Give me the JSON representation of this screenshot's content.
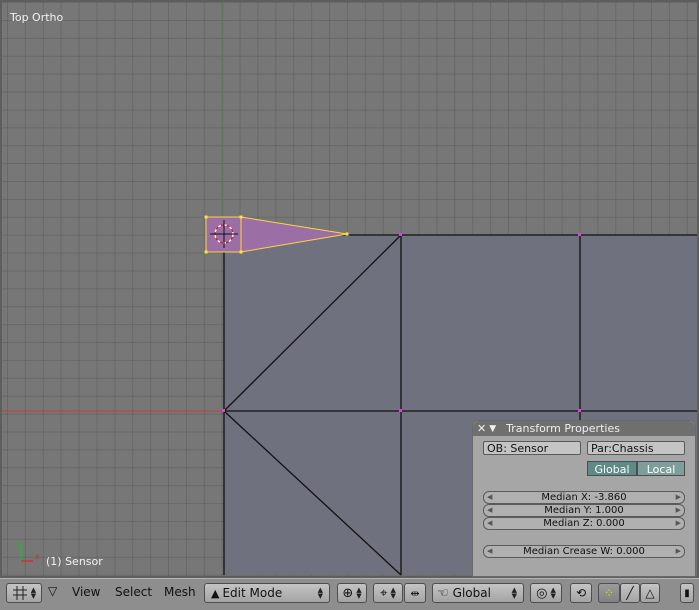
{
  "viewport": {
    "view_label": "Top Ortho",
    "object_label": "(1) Sensor"
  },
  "transform_panel": {
    "title": "Transform Properties",
    "ob_name": "OB: Sensor",
    "parent": "Par:Chassis",
    "global_label": "Global",
    "local_label": "Local",
    "median_x": "Median X: -3.860",
    "median_y": "Median Y: 1.000",
    "median_z": "Median Z: 0.000",
    "median_crease": "Median Crease W: 0.000"
  },
  "header": {
    "view_menu": "View",
    "select_menu": "Select",
    "mesh_menu": "Mesh",
    "mode": "Edit Mode",
    "orientation": "Global"
  },
  "icons": [
    "grid-icon",
    "view-menu-triangle-icon",
    "mesh-mode-icon",
    "draw-type-icon",
    "pivot-icon",
    "manipulator-icon",
    "hand-icon",
    "proportional-icon",
    "lock-icon",
    "vertex-select-icon",
    "edge-select-icon",
    "face-select-icon",
    "axis-widget-icon",
    "close-icon",
    "collapse-icon"
  ],
  "colors": {
    "grid_bg": "#777777",
    "mesh_face": "#6f727e",
    "selected_face": "#9b6fa6",
    "selected_edge": "#ffd53a",
    "x_axis": "#cc3333"
  }
}
